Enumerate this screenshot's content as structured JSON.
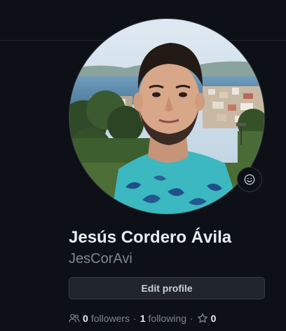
{
  "profile": {
    "full_name": "Jesús Cordero Ávila",
    "username": "JesCorAvi",
    "edit_label": "Edit profile",
    "followers_count": "0",
    "followers_label": "followers",
    "following_count": "1",
    "following_label": "following",
    "separator": "·",
    "stars_count": "0"
  },
  "icons": {
    "people": "people-icon",
    "star": "star-icon",
    "status": "smiley-icon"
  },
  "colors": {
    "background": "#0d1117",
    "text_primary": "#e6edf3",
    "text_muted": "#7d8590",
    "button_bg": "#21262d",
    "border": "#30363d"
  }
}
